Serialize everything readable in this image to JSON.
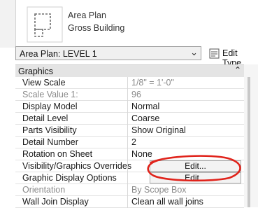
{
  "type_selector": {
    "icon": "area-plan-icon",
    "line1": "Area Plan",
    "line2": "Gross Building"
  },
  "instance": {
    "selected": "Area Plan: LEVEL 1",
    "edit_type_label": "Edit Type"
  },
  "section": {
    "label": "Graphics",
    "collapse_glyph": "⌃"
  },
  "rows": [
    {
      "name": "View Scale",
      "value": "1/8\" = 1'-0\""
    },
    {
      "name": "Scale Value    1:",
      "value": "96"
    },
    {
      "name": "Display Model",
      "value": "Normal"
    },
    {
      "name": "Detail Level",
      "value": "Coarse"
    },
    {
      "name": "Parts Visibility",
      "value": "Show Original"
    },
    {
      "name": "Detail Number",
      "value": "2"
    },
    {
      "name": "Rotation on Sheet",
      "value": "None"
    },
    {
      "name": "Visibility/Graphics Overrides",
      "value": "Edit..."
    },
    {
      "name": "Graphic Display Options",
      "value": "Edit..."
    },
    {
      "name": "Orientation",
      "value": "By Scope Box"
    },
    {
      "name": "Wall Join Display",
      "value": "Clean all wall joins"
    }
  ],
  "colors": {
    "annotation_red": "#e0231b"
  }
}
